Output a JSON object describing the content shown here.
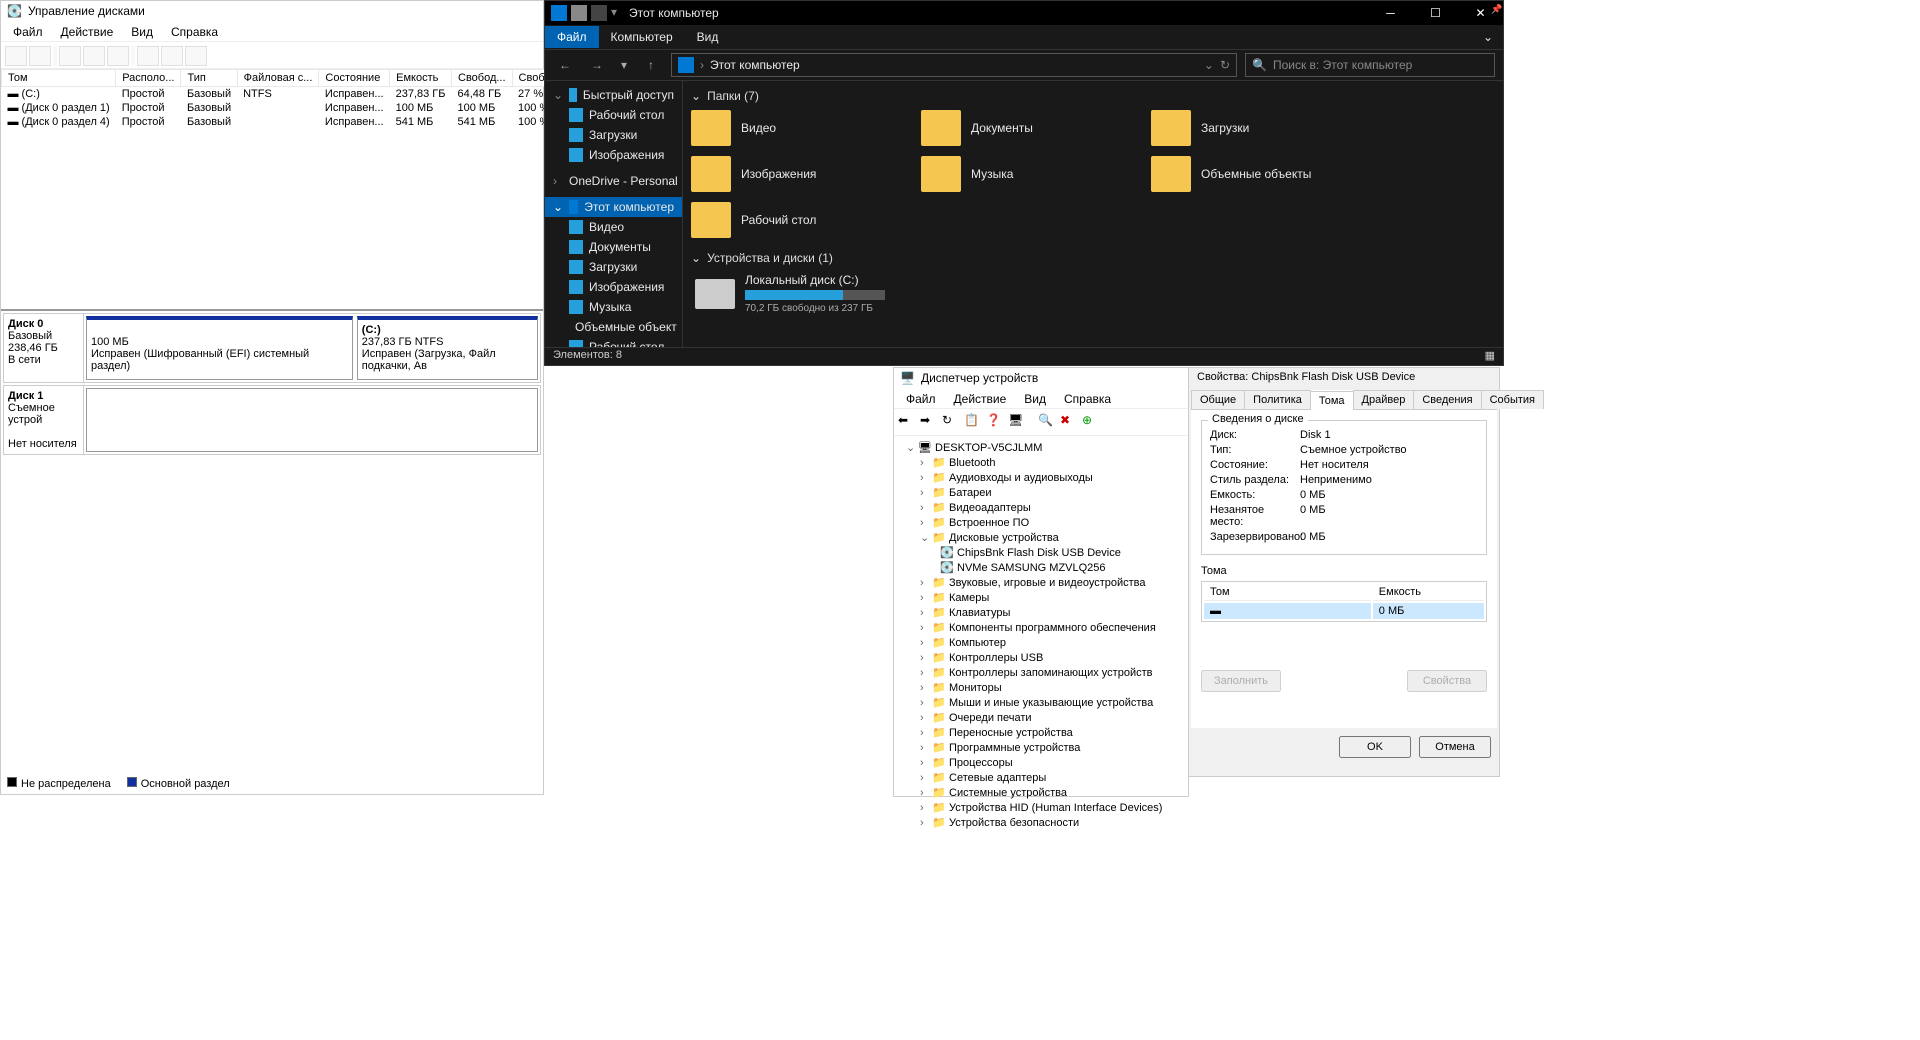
{
  "diskmgmt": {
    "title": "Управление дисками",
    "menu": [
      "Файл",
      "Действие",
      "Вид",
      "Справка"
    ],
    "cols": [
      "Том",
      "Располо...",
      "Тип",
      "Файловая с...",
      "Состояние",
      "Емкость",
      "Свобод...",
      "Свободно %"
    ],
    "vols": [
      {
        "name": "(C:)",
        "layout": "Простой",
        "type": "Базовый",
        "fs": "NTFS",
        "status": "Исправен...",
        "cap": "237,83 ГБ",
        "free": "64,48 ГБ",
        "pct": "27 %"
      },
      {
        "name": "(Диск 0 раздел 1)",
        "layout": "Простой",
        "type": "Базовый",
        "fs": "",
        "status": "Исправен...",
        "cap": "100 МБ",
        "free": "100 МБ",
        "pct": "100 %"
      },
      {
        "name": "(Диск 0 раздел 4)",
        "layout": "Простой",
        "type": "Базовый",
        "fs": "",
        "status": "Исправен...",
        "cap": "541 МБ",
        "free": "541 МБ",
        "pct": "100 %"
      }
    ],
    "disk0": {
      "label": "Диск 0",
      "type": "Базовый",
      "size": "238,46 ГБ",
      "status": "В сети",
      "p1": {
        "size": "100 МБ",
        "desc": "Исправен (Шифрованный (EFI) системный раздел)"
      },
      "p2": {
        "name": "(C:)",
        "size": "237,83 ГБ NTFS",
        "desc": "Исправен (Загрузка, Файл подкачки, Ав"
      }
    },
    "disk1": {
      "label": "Диск 1",
      "type": "Съемное устрой",
      "size": "",
      "status": "Нет носителя"
    },
    "legend": {
      "unalloc": "Не распределена",
      "primary": "Основной раздел"
    }
  },
  "explorer": {
    "title": "Этот компьютер",
    "ribbon": {
      "file": "Файл",
      "computer": "Компьютер",
      "view": "Вид"
    },
    "addr": "Этот компьютер",
    "search_ph": "Поиск в: Этот компьютер",
    "side": {
      "quick": "Быстрый доступ",
      "desktop": "Рабочий стол",
      "downloads": "Загрузки",
      "pictures": "Изображения",
      "onedrive": "OneDrive - Personal",
      "thispc": "Этот компьютер",
      "video": "Видео",
      "documents": "Документы",
      "downloads2": "Загрузки",
      "pictures2": "Изображения",
      "music": "Музыка",
      "objects3d": "Объемные объект",
      "desktop2": "Рабочий стол"
    },
    "folders_head": "Папки (7)",
    "folders": [
      "Видео",
      "Документы",
      "Загрузки",
      "Изображения",
      "Музыка",
      "Объемные объекты",
      "Рабочий стол"
    ],
    "drives_head": "Устройства и диски (1)",
    "drive": {
      "name": "Локальный диск (C:)",
      "free": "70,2 ГБ свободно из 237 ГБ"
    },
    "status": "Элементов: 8"
  },
  "devmgr": {
    "title": "Диспетчер устройств",
    "menu": [
      "Файл",
      "Действие",
      "Вид",
      "Справка"
    ],
    "root": "DESKTOP-V5CJLMM",
    "cats": [
      {
        "n": "Bluetooth"
      },
      {
        "n": "Аудиовходы и аудиовыходы"
      },
      {
        "n": "Батареи"
      },
      {
        "n": "Видеоадаптеры"
      },
      {
        "n": "Встроенное ПО"
      },
      {
        "n": "Дисковые устройства",
        "open": true,
        "kids": [
          "ChipsBnk Flash Disk USB Device",
          "NVMe SAMSUNG MZVLQ256"
        ]
      },
      {
        "n": "Звуковые, игровые и видеоустройства"
      },
      {
        "n": "Камеры"
      },
      {
        "n": "Клавиатуры"
      },
      {
        "n": "Компоненты программного обеспечения"
      },
      {
        "n": "Компьютер"
      },
      {
        "n": "Контроллеры USB"
      },
      {
        "n": "Контроллеры запоминающих устройств"
      },
      {
        "n": "Мониторы"
      },
      {
        "n": "Мыши и иные указывающие устройства"
      },
      {
        "n": "Очереди печати"
      },
      {
        "n": "Переносные устройства"
      },
      {
        "n": "Программные устройства"
      },
      {
        "n": "Процессоры"
      },
      {
        "n": "Сетевые адаптеры"
      },
      {
        "n": "Системные устройства"
      },
      {
        "n": "Устройства HID (Human Interface Devices)"
      },
      {
        "n": "Устройства безопасности"
      }
    ]
  },
  "props": {
    "title": "Свойства: ChipsBnk Flash Disk USB Device",
    "tabs": [
      "Общие",
      "Политика",
      "Тома",
      "Драйвер",
      "Сведения",
      "События"
    ],
    "group1": "Сведения о диске",
    "rows": [
      {
        "l": "Диск:",
        "v": "Disk 1"
      },
      {
        "l": "Тип:",
        "v": "Съемное устройство"
      },
      {
        "l": "Состояние:",
        "v": "Нет носителя"
      },
      {
        "l": "Стиль раздела:",
        "v": "Неприменимо"
      },
      {
        "l": "Емкость:",
        "v": "0 МБ"
      },
      {
        "l": "Незанятое место:",
        "v": "0 МБ"
      },
      {
        "l": "Зарезервировано:",
        "v": "0 МБ"
      }
    ],
    "group2": "Тома",
    "th": {
      "vol": "Том",
      "cap": "Емкость"
    },
    "td": {
      "vol": "",
      "cap": "0 МБ"
    },
    "btn_fill": "Заполнить",
    "btn_props": "Свойства",
    "ok": "OK",
    "cancel": "Отмена"
  }
}
